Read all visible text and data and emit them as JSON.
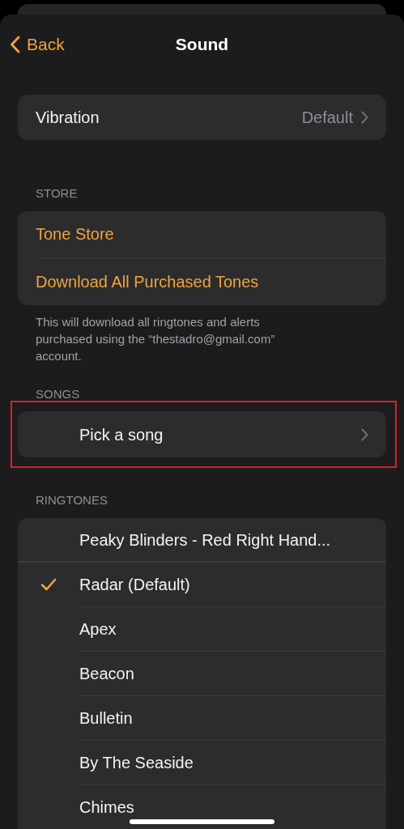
{
  "nav": {
    "back": "Back",
    "title": "Sound"
  },
  "vibration": {
    "label": "Vibration",
    "value": "Default"
  },
  "store": {
    "header": "STORE",
    "items": [
      "Tone Store",
      "Download All Purchased Tones"
    ],
    "footer": "This will download all ringtones and alerts purchased using the “thestadro@gmail.com” account."
  },
  "songs": {
    "header": "SONGS",
    "item": "Pick a song",
    "highlighted": true
  },
  "ringtones": {
    "header": "RINGTONES",
    "recent": [
      {
        "label": "Peaky Blinders - Red Right Hand...",
        "selected": false
      }
    ],
    "items": [
      {
        "label": "Radar (Default)",
        "selected": true
      },
      {
        "label": "Apex",
        "selected": false
      },
      {
        "label": "Beacon",
        "selected": false
      },
      {
        "label": "Bulletin",
        "selected": false
      },
      {
        "label": "By The Seaside",
        "selected": false
      },
      {
        "label": "Chimes",
        "selected": false
      }
    ]
  }
}
